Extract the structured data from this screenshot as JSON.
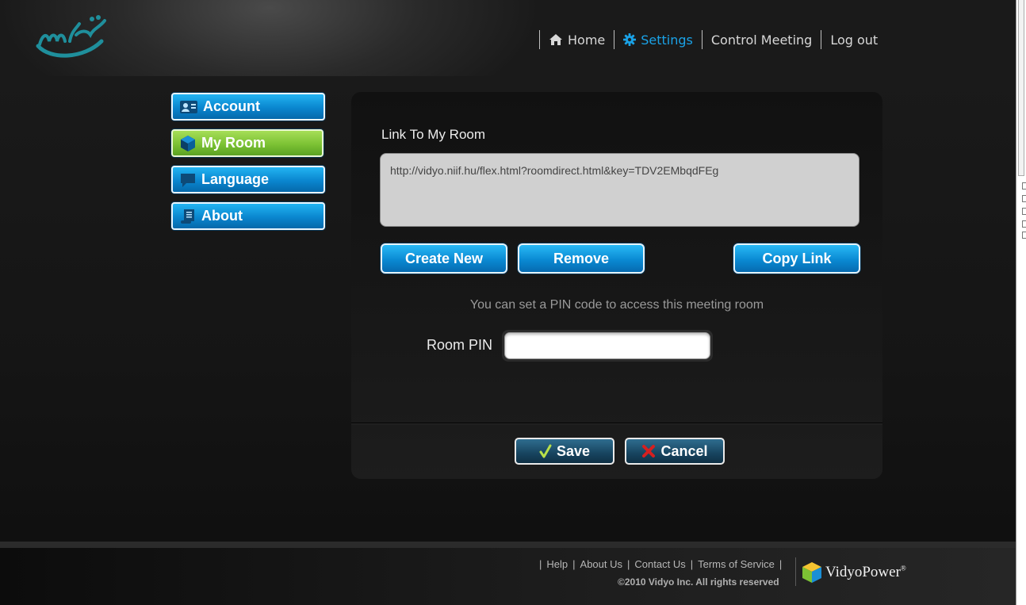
{
  "nav": {
    "home": "Home",
    "settings": "Settings",
    "control_meeting": "Control Meeting",
    "logout": "Log out"
  },
  "sidebar": {
    "items": [
      {
        "label": "Account",
        "icon": "account-card-icon"
      },
      {
        "label": "My Room",
        "icon": "room-cube-icon",
        "active": true
      },
      {
        "label": "Language",
        "icon": "speech-bubble-icon"
      },
      {
        "label": "About",
        "icon": "scroll-icon"
      }
    ]
  },
  "panel": {
    "title": "Link To My Room",
    "link": "http://vidyo.niif.hu/flex.html?roomdirect.html&key=TDV2EMbqdFEg",
    "create_new": "Create New",
    "remove": "Remove",
    "copy_link": "Copy Link",
    "pin_hint": "You can set a PIN code to access this meeting room",
    "pin_label": "Room PIN",
    "pin_value": "",
    "save": "Save",
    "cancel": "Cancel"
  },
  "footer": {
    "links": [
      "Help",
      "About Us",
      "Contact Us",
      "Terms of Service"
    ],
    "copyright": "©2010 Vidyo Inc. All rights reserved",
    "brand": "VidyoPower",
    "brand_mark": "®"
  },
  "colors": {
    "accent_blue": "#1aa3e8",
    "active_green": "#7cc234",
    "logo_teal": "#1f8f9c"
  }
}
